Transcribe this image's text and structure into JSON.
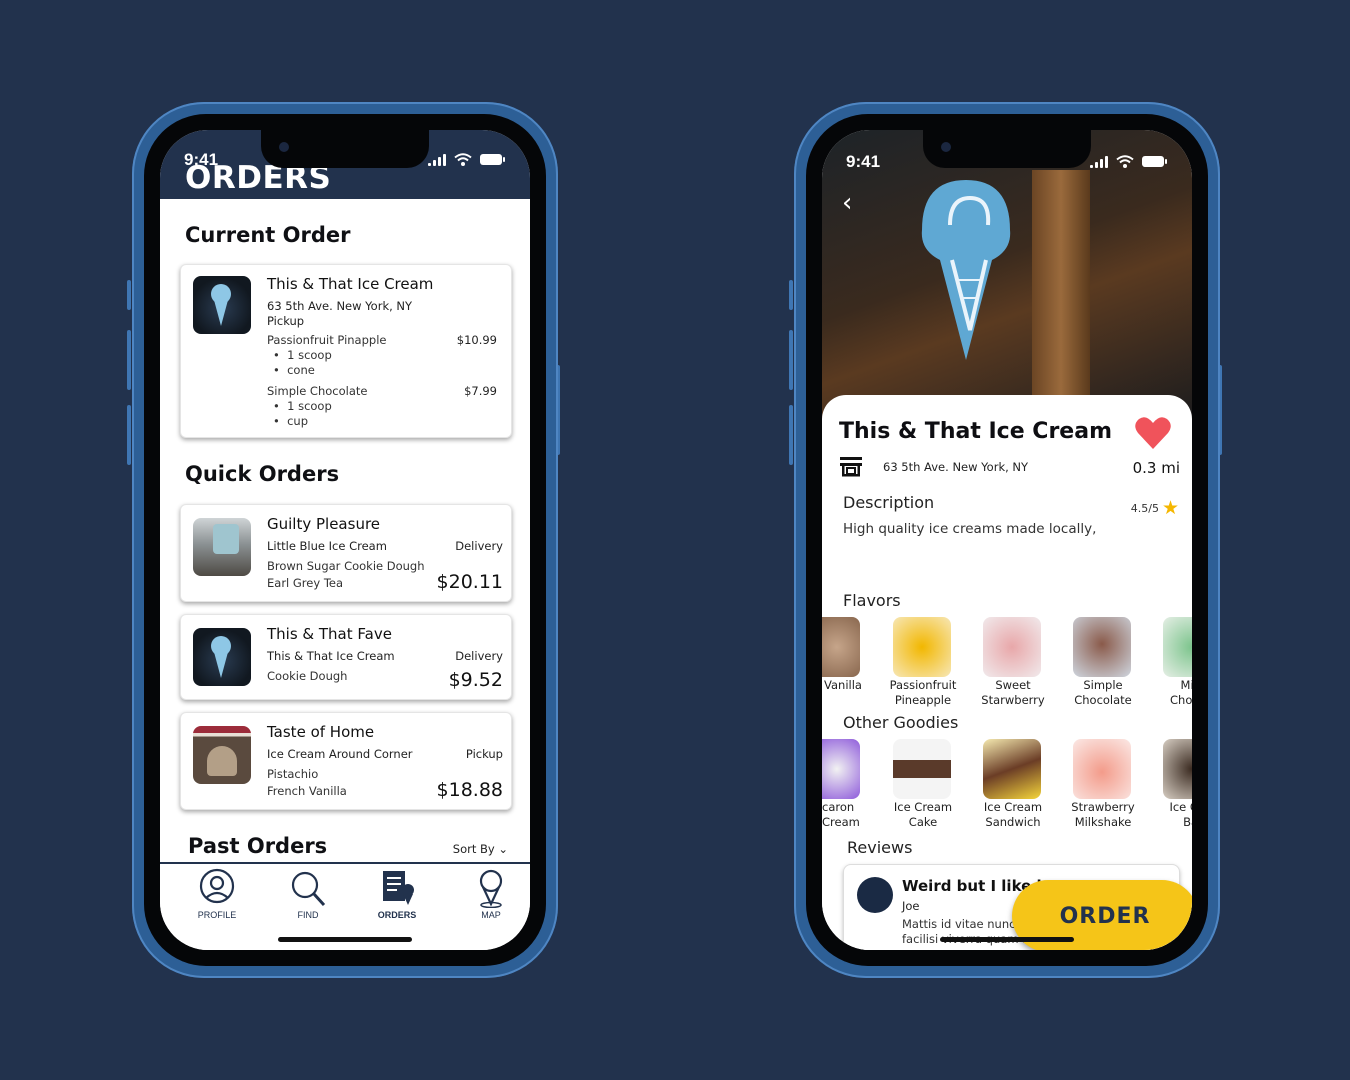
{
  "left_phone": {
    "status": {
      "time": "9:41"
    },
    "header": {
      "title": "ORDERS"
    },
    "current": {
      "section_title": "Current Order",
      "shop": "This & That Ice Cream",
      "address": "63 5th Ave. New York, NY",
      "mode": "Pickup",
      "items": [
        {
          "name": "Passionfruit Pinapple",
          "price": "$10.99",
          "details": [
            "1 scoop",
            "cone"
          ]
        },
        {
          "name": "Simple Chocolate",
          "price": "$7.99",
          "details": [
            "1 scoop",
            "cup"
          ]
        }
      ]
    },
    "quick": {
      "section_title": "Quick Orders",
      "cards": [
        {
          "name": "Guilty Pleasure",
          "shop": "Little Blue Ice Cream",
          "mode": "Delivery",
          "items": [
            "Brown Sugar Cookie Dough",
            "Earl Grey Tea"
          ],
          "price": "$20.11"
        },
        {
          "name": "This & That Fave",
          "shop": "This & That Ice Cream",
          "mode": "Delivery",
          "items": [
            "Cookie Dough"
          ],
          "price": "$9.52"
        },
        {
          "name": "Taste of Home",
          "shop": "Ice Cream Around Corner",
          "mode": "Pickup",
          "items": [
            "Pistachio",
            "French Vanilla"
          ],
          "price": "$18.88"
        }
      ]
    },
    "past": {
      "section_title": "Past Orders",
      "sort_label": "Sort By"
    },
    "nav": [
      {
        "label": "PROFILE",
        "icon": "profile-icon"
      },
      {
        "label": "FIND",
        "icon": "search-icon"
      },
      {
        "label": "ORDERS",
        "icon": "orders-icon",
        "active": true
      },
      {
        "label": "MAP",
        "icon": "map-pin-icon"
      }
    ]
  },
  "right_phone": {
    "status": {
      "time": "9:41"
    },
    "shop": {
      "name": "This & That Ice Cream",
      "address": "63 5th Ave. New York, NY",
      "distance": "0.3 mi",
      "rating": "4.5/5"
    },
    "description": {
      "label": "Description",
      "text": "High quality ice creams made locally,"
    },
    "flavors": {
      "label": "Flavors",
      "items": [
        {
          "l1": "Vanilla",
          "l2": ""
        },
        {
          "l1": "Passionfruit",
          "l2": "Pineapple"
        },
        {
          "l1": "Sweet",
          "l2": "Starwberry"
        },
        {
          "l1": "Simple",
          "l2": "Chocolate"
        },
        {
          "l1": "Mint",
          "l2": "Chocola"
        }
      ]
    },
    "goodies": {
      "label": "Other Goodies",
      "items": [
        {
          "l1": "caron",
          "l2": "Cream"
        },
        {
          "l1": "Ice Cream",
          "l2": "Cake"
        },
        {
          "l1": "Ice Cream",
          "l2": "Sandwich"
        },
        {
          "l1": "Strawberry",
          "l2": "Milkshake"
        },
        {
          "l1": "Ice Crea",
          "l2": "Bar"
        }
      ]
    },
    "reviews": {
      "label": "Reviews",
      "title": "Weird but I like i",
      "user": "Joe",
      "text": "Mattis id vitae nunc c justo, in. Amet, dui cur facilisi viverra quam adipiscing placerat enim..."
    },
    "order_button": "ORDER",
    "colors": {
      "accent": "#f5c518",
      "navy": "#22324d",
      "heart": "#f0535b",
      "star": "#f5b700"
    }
  }
}
